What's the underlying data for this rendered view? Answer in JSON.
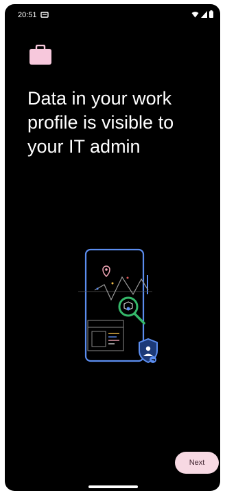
{
  "status_bar": {
    "time": "20:51",
    "icons": [
      "notification-icon",
      "wifi-icon",
      "signal-icon",
      "battery-icon"
    ]
  },
  "header": {
    "icon": "briefcase-icon",
    "headline": "Data in your work profile is visible to your IT admin"
  },
  "footer": {
    "next_label": "Next"
  },
  "colors": {
    "background": "#000000",
    "briefcase": "#f7c8dc",
    "button_bg": "#f7d9e3",
    "button_text": "#3b1f2b",
    "illustration_blue": "#5b8def",
    "illustration_green": "#35b86a"
  }
}
